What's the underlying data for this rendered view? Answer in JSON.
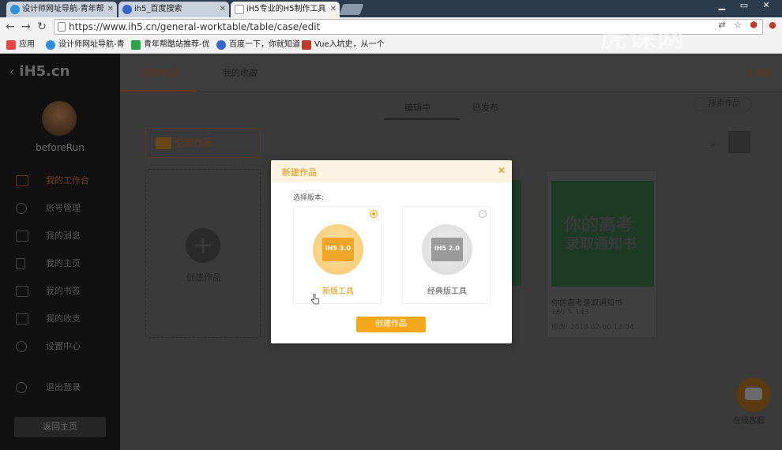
{
  "browser": {
    "tabs": [
      {
        "title": "设计师网址导航-青年帮",
        "icon_color": "#2d8fdd"
      },
      {
        "title": "ih5_百度搜索",
        "icon_color": "#3366cc"
      },
      {
        "title": "iH5专业的H5制作工具",
        "icon_color": "#ffffff"
      }
    ],
    "url": "https://www.ih5.cn/general-worktable/table/case/edit",
    "bookmarks": [
      {
        "label": "应用",
        "icon_color": "#e44"
      },
      {
        "label": "设计师网址导航-青",
        "icon_color": "#2d8fdd"
      },
      {
        "label": "青年帮酷站推荐-优",
        "icon_color": "#2aa34a"
      },
      {
        "label": "百度一下，你就知道",
        "icon_color": "#3366cc"
      },
      {
        "label": "Vue入坑史，从一个",
        "icon_color": "#c0392b"
      }
    ]
  },
  "app": {
    "brand": "iH5.cn",
    "username": "beforeRun",
    "menu": [
      {
        "label": "我的工作台",
        "active": true
      },
      {
        "label": "账号管理"
      },
      {
        "label": "我的消息"
      },
      {
        "label": "我的主页"
      },
      {
        "label": "我的书签"
      },
      {
        "label": "我的收支"
      },
      {
        "label": "设置中心"
      },
      {
        "label": "退出登录"
      }
    ],
    "home_button": "返回主页",
    "topnav": {
      "my_works": "我的作品",
      "my_favorites": "我的收藏",
      "switch_version": "新版"
    },
    "subtabs": {
      "editing": "编辑中",
      "published": "已发布"
    },
    "search_works": "搜索作品",
    "all_works": "全部作品",
    "create_work": "创建作品",
    "card": {
      "title": "你的高考录取通知书",
      "poster_line1": "你的高考",
      "poster_line2": "录取通知书",
      "stats": "180  ✎ 143",
      "date": "修改: 2018 07-00 12:04"
    },
    "online_service": "在线客服"
  },
  "modal": {
    "title": "新建作品",
    "version_label": "选择版本:",
    "options": [
      {
        "badge": "iH5 3.0",
        "name": "新版工具",
        "selected": true,
        "accent": "#f2a51a"
      },
      {
        "badge": "iH5 2.0",
        "name": "经典版工具",
        "selected": false,
        "accent": "#9a9a9a"
      }
    ],
    "submit": "创建作品"
  },
  "watermark": "虎课网"
}
